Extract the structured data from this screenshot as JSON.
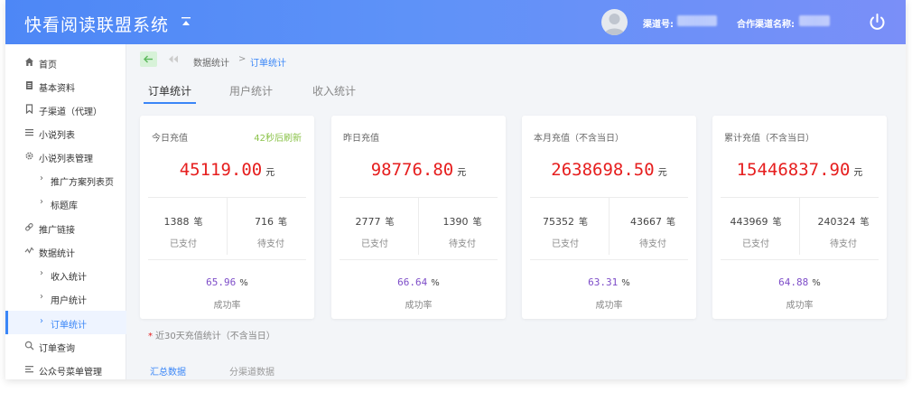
{
  "header": {
    "title": "快看阅读联盟系统",
    "channel_label": "渠道号:",
    "partner_label": "合作渠道名称:"
  },
  "sidebar": {
    "items": [
      {
        "label": "首页",
        "icon": "home-icon"
      },
      {
        "label": "基本资料",
        "icon": "document-icon"
      },
      {
        "label": "子渠道（代理）",
        "icon": "bookmark-icon"
      },
      {
        "label": "小说列表",
        "icon": "list-icon"
      },
      {
        "label": "小说列表管理",
        "icon": "gear-icon"
      },
      {
        "label": "推广方案列表页",
        "sub": true
      },
      {
        "label": "标题库",
        "sub": true
      },
      {
        "label": "推广链接",
        "icon": "link-icon"
      },
      {
        "label": "数据统计",
        "icon": "chart-icon"
      },
      {
        "label": "收入统计",
        "sub": true
      },
      {
        "label": "用户统计",
        "sub": true
      },
      {
        "label": "订单统计",
        "sub": true,
        "active": true
      },
      {
        "label": "订单查询",
        "icon": "search-icon"
      },
      {
        "label": "公众号菜单管理",
        "icon": "menu-icon"
      }
    ]
  },
  "breadcrumb": {
    "parent": "数据统计",
    "separator": ">",
    "current": "订单统计"
  },
  "tabs": [
    "订单统计",
    "用户统计",
    "收入统计"
  ],
  "cards": [
    {
      "title": "今日充值",
      "refresh": "42秒后刷新",
      "amount": "45119.00",
      "amount_unit": "元",
      "paid": "1388",
      "pending": "716",
      "count_unit": "笔",
      "paid_label": "已支付",
      "pending_label": "待支付",
      "rate": "65.96",
      "rate_unit": "%",
      "rate_label": "成功率"
    },
    {
      "title": "昨日充值",
      "amount": "98776.80",
      "amount_unit": "元",
      "paid": "2777",
      "pending": "1390",
      "count_unit": "笔",
      "paid_label": "已支付",
      "pending_label": "待支付",
      "rate": "66.64",
      "rate_unit": "%",
      "rate_label": "成功率"
    },
    {
      "title": "本月充值（不含当日）",
      "amount": "2638698.50",
      "amount_unit": "元",
      "paid": "75352",
      "pending": "43667",
      "count_unit": "笔",
      "paid_label": "已支付",
      "pending_label": "待支付",
      "rate": "63.31",
      "rate_unit": "%",
      "rate_label": "成功率"
    },
    {
      "title": "累计充值（不含当日）",
      "amount": "15446837.90",
      "amount_unit": "元",
      "paid": "443969",
      "pending": "240324",
      "count_unit": "笔",
      "paid_label": "已支付",
      "pending_label": "待支付",
      "rate": "64.88",
      "rate_unit": "%",
      "rate_label": "成功率"
    }
  ],
  "note": {
    "star": "*",
    "text": "近30天充值统计（不含当日）"
  },
  "bottom_tabs": [
    "汇总数据",
    "分渠道数据"
  ],
  "colors": {
    "accent": "#3a86f7",
    "amount": "#e61e1e",
    "rate": "#7d4cc8",
    "refresh": "#8bc34a"
  }
}
